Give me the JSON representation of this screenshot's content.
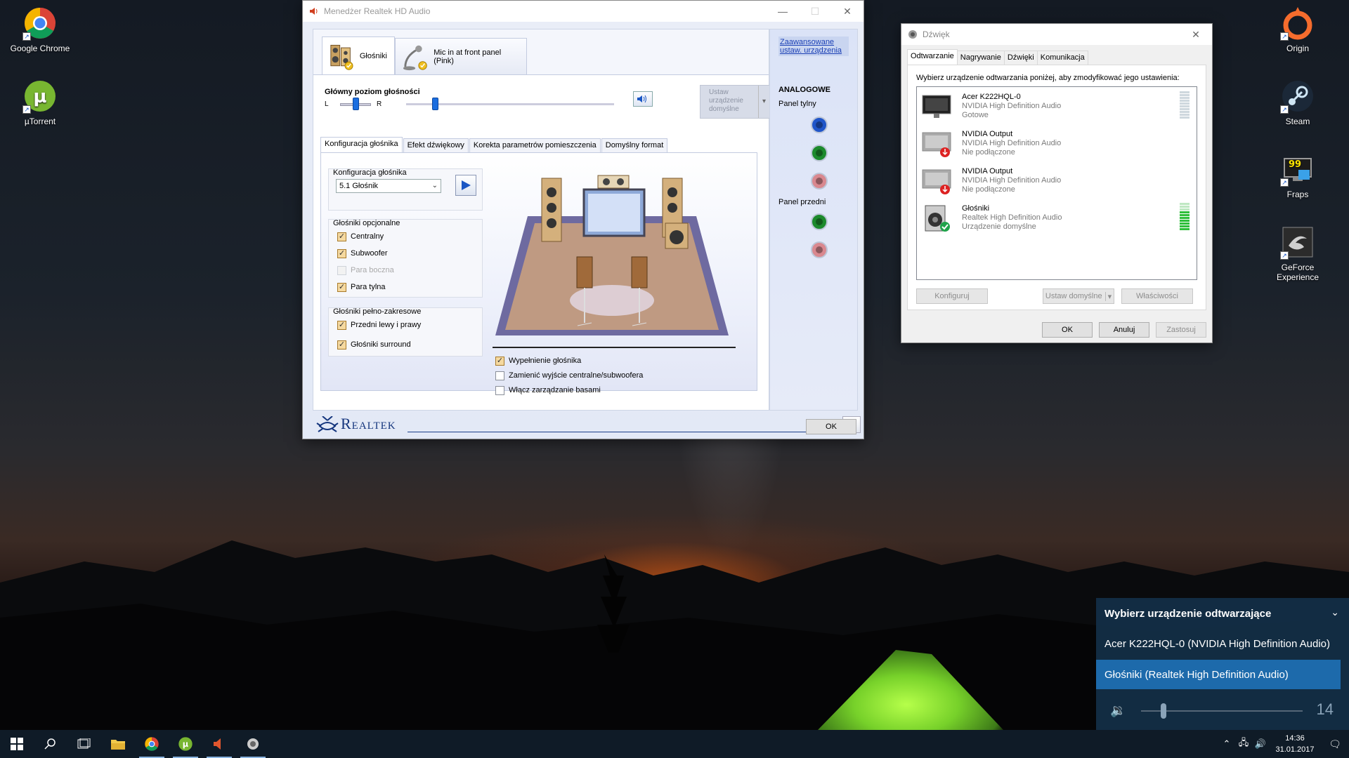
{
  "desktop": {
    "icons_left": [
      {
        "label": "Google Chrome",
        "icon": "chrome-icon"
      },
      {
        "label": "µTorrent",
        "icon": "utorrent-icon"
      }
    ],
    "icons_right": [
      {
        "label": "Origin",
        "icon": "origin-icon"
      },
      {
        "label": "Steam",
        "icon": "steam-icon"
      },
      {
        "label": "Fraps",
        "icon": "fraps-icon",
        "badge": "99"
      },
      {
        "label": "GeForce Experience",
        "icon": "geforce-icon"
      }
    ]
  },
  "realtek": {
    "title": "Menedżer Realtek HD Audio",
    "device_tabs": [
      "Głośniki",
      "Mic in at front panel (Pink)"
    ],
    "volume": {
      "title": "Główny poziom głośności",
      "left_label": "L",
      "right_label": "R",
      "balance": 0.5,
      "level": 0.14
    },
    "set_default": "Ustaw urządzenie domyślne",
    "sub_tabs": [
      "Konfiguracja głośnika",
      "Efekt dźwiękowy",
      "Korekta parametrów pomieszczenia",
      "Domyślny format"
    ],
    "config": {
      "group_title": "Konfiguracja głośnika",
      "selected": "5.1 Głośnik"
    },
    "optional": {
      "title": "Głośniki opcjonalne",
      "items": [
        {
          "label": "Centralny",
          "checked": true,
          "enabled": true
        },
        {
          "label": "Subwoofer",
          "checked": true,
          "enabled": true
        },
        {
          "label": "Para boczna",
          "checked": false,
          "enabled": false
        },
        {
          "label": "Para tylna",
          "checked": true,
          "enabled": true
        }
      ]
    },
    "fullrange": {
      "title": "Głośniki pełno-zakresowe",
      "items": [
        {
          "label": "Przedni lewy i prawy",
          "checked": true
        },
        {
          "label": "Głośniki surround",
          "checked": true
        }
      ]
    },
    "options": [
      {
        "label": "Wypełnienie głośnika",
        "checked": true
      },
      {
        "label": "Zamienić wyjście centralne/subwoofera",
        "checked": false
      },
      {
        "label": "Włącz zarządzanie basami",
        "checked": false
      }
    ],
    "side": {
      "advanced_link": "Zaawansowane ustaw. urządzenia",
      "analog_title": "ANALOGOWE",
      "rear_label": "Panel tylny",
      "front_label": "Panel przedni",
      "rear_jacks": [
        "#1f55c9",
        "#1c8a2c",
        "#d9888f"
      ],
      "front_jacks": [
        "#1c8a2c",
        "#d9888f"
      ]
    },
    "brand": "Realtek",
    "ok": "OK"
  },
  "sound": {
    "title": "Dźwięk",
    "tabs": [
      "Odtwarzanie",
      "Nagrywanie",
      "Dźwięki",
      "Komunikacja"
    ],
    "description": "Wybierz urządzenie odtwarzania poniżej, aby zmodyfikować jego ustawienia:",
    "devices": [
      {
        "name": "Acer K222HQL-0",
        "driver": "NVIDIA High Definition Audio",
        "status": "Gotowe",
        "icon": "monitor-icon",
        "level_color": "#cfd8de"
      },
      {
        "name": "NVIDIA Output",
        "driver": "NVIDIA High Definition Audio",
        "status": "Nie podłączone",
        "icon": "monitor-disconnected-icon",
        "level_color": ""
      },
      {
        "name": "NVIDIA Output",
        "driver": "NVIDIA High Definition Audio",
        "status": "Nie podłączone",
        "icon": "monitor-disconnected-icon",
        "level_color": ""
      },
      {
        "name": "Głośniki",
        "driver": "Realtek High Definition Audio",
        "status": "Urządzenie domyślne",
        "icon": "speaker-default-icon",
        "level_color": "#2fbf3a"
      }
    ],
    "configure": "Konfiguruj",
    "set_default": "Ustaw domyślne",
    "properties": "Właściwości",
    "ok": "OK",
    "cancel": "Anuluj",
    "apply": "Zastosuj"
  },
  "flyout": {
    "title": "Wybierz urządzenie odtwarzające",
    "items": [
      {
        "label": "Acer K222HQL-0 (NVIDIA High Definition Audio)",
        "selected": false
      },
      {
        "label": "Głośniki (Realtek High Definition Audio)",
        "selected": true
      }
    ],
    "volume": "14",
    "volume_level": 0.14
  },
  "taskbar": {
    "time": "14:36",
    "date": "31.01.2017"
  }
}
